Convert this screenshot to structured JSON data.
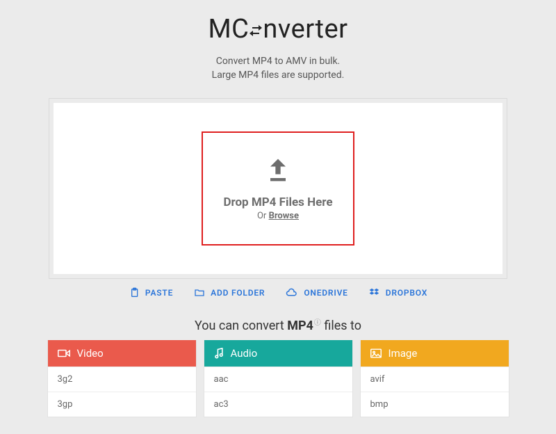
{
  "brand": {
    "pre": "MC",
    "post": "nverter"
  },
  "subtitle": {
    "line1": "Convert MP4 to AMV in bulk.",
    "line2": "Large MP4 files are supported."
  },
  "dropzone": {
    "title": "Drop MP4 Files Here",
    "or": "Or ",
    "browse": "Browse"
  },
  "actions": {
    "paste": "PASTE",
    "addfolder": "ADD FOLDER",
    "onedrive": "ONEDRIVE",
    "dropbox": "DROPBOX"
  },
  "convert_heading": {
    "pre": "You can convert ",
    "bold": "MP4",
    "post": " files to"
  },
  "categories": {
    "video": {
      "label": "Video",
      "items": [
        "3g2",
        "3gp"
      ]
    },
    "audio": {
      "label": "Audio",
      "items": [
        "aac",
        "ac3"
      ]
    },
    "image": {
      "label": "Image",
      "items": [
        "avif",
        "bmp"
      ]
    }
  }
}
